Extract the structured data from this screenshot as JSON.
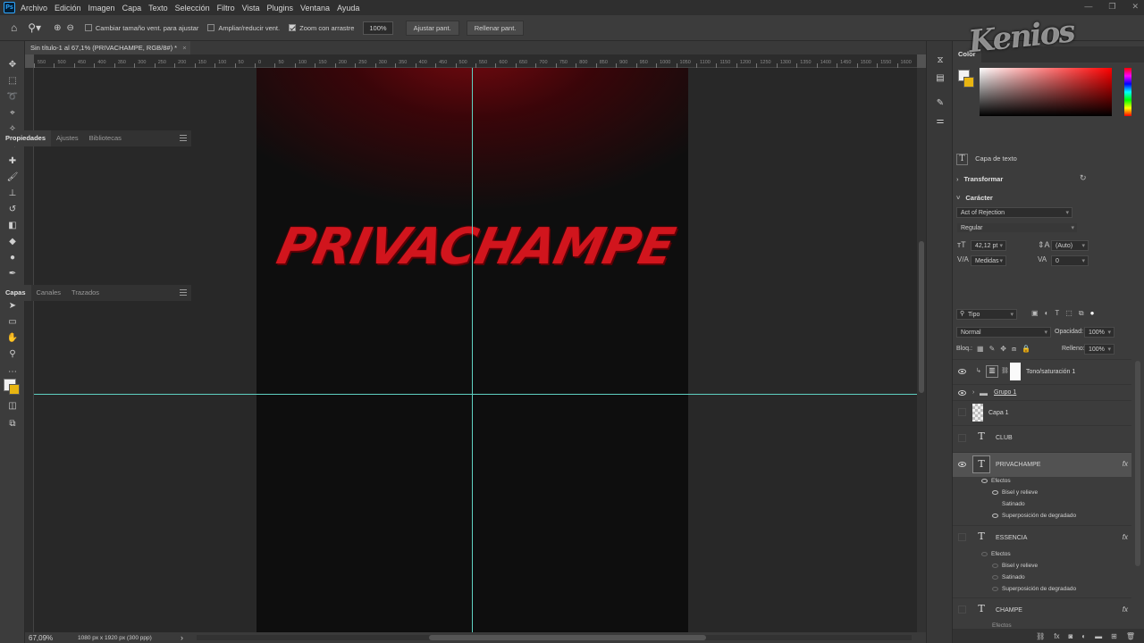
{
  "menu": {
    "logo": "Ps",
    "items": [
      "Archivo",
      "Edición",
      "Imagen",
      "Capa",
      "Texto",
      "Selección",
      "Filtro",
      "Vista",
      "Plugins",
      "Ventana",
      "Ayuda"
    ]
  },
  "options": {
    "resize_windows": "Cambiar tamaño vent. para ajustar",
    "zoom_all": "Ampliar/reducir vent.",
    "scrubby_zoom": "Zoom con arrastre",
    "zoom_value": "100%",
    "fit_screen": "Ajustar pant.",
    "fill_screen": "Rellenar pant."
  },
  "document": {
    "tab": "Sin título-1 al 67,1% (PRIVACHAMPE, RGB/8#) *",
    "close": "×"
  },
  "ruler": {
    "ticks": [
      "550",
      "500",
      "450",
      "400",
      "350",
      "300",
      "250",
      "200",
      "150",
      "100",
      "50",
      "0",
      "50",
      "100",
      "150",
      "200",
      "250",
      "300",
      "350",
      "400",
      "450",
      "500",
      "550",
      "600",
      "650",
      "700",
      "750",
      "800",
      "850",
      "900",
      "950",
      "1000",
      "1050",
      "1100",
      "1150",
      "1200",
      "1250",
      "1300",
      "1350",
      "1400",
      "1450",
      "1500",
      "1550",
      "1600"
    ]
  },
  "canvas": {
    "headline": "PRIVACHAMPE",
    "accent": "#d1151d",
    "guide": "#5fd1c2"
  },
  "status": {
    "zoom": "67,09%",
    "dims": "1080 px x 1920 px (300 ppp)",
    "arrow": "›"
  },
  "color_panel": {
    "title": "Color",
    "fg": "#f2f2f2",
    "bg": "#e8b511"
  },
  "properties": {
    "tabs": [
      "Propiedades",
      "Ajustes",
      "Bibliotecas"
    ],
    "layer_kind": "Capa de texto",
    "transform": "Transformar",
    "character": "Carácter",
    "font": "Act of Rejection",
    "style": "Regular",
    "size": "42,12 pt",
    "leading": "(Auto)",
    "kerning": "Medidas",
    "tracking": "0"
  },
  "layers_panel": {
    "tabs": [
      "Capas",
      "Canales",
      "Trazados"
    ],
    "filter": "Tipo",
    "blend": "Normal",
    "opacity_label": "Opacidad:",
    "opacity": "100%",
    "lock_label": "Bloq.:",
    "fill_label": "Relleno:",
    "fill": "100%",
    "layers": [
      {
        "name": "Tono/saturación 1"
      },
      {
        "name": "Grupo 1"
      },
      {
        "name": "Capa 1"
      },
      {
        "name": "CLUB"
      },
      {
        "name": "PRIVACHAMPE"
      },
      {
        "name": "ESSENCIA"
      },
      {
        "name": "CHAMPE"
      }
    ],
    "effects_label": "Efectos",
    "effects": [
      "Bisel y relieve",
      "Satinado",
      "Superposición de degradado"
    ],
    "fx": "fx",
    "partial_label": "Efectos"
  },
  "watermark": "Kenios"
}
